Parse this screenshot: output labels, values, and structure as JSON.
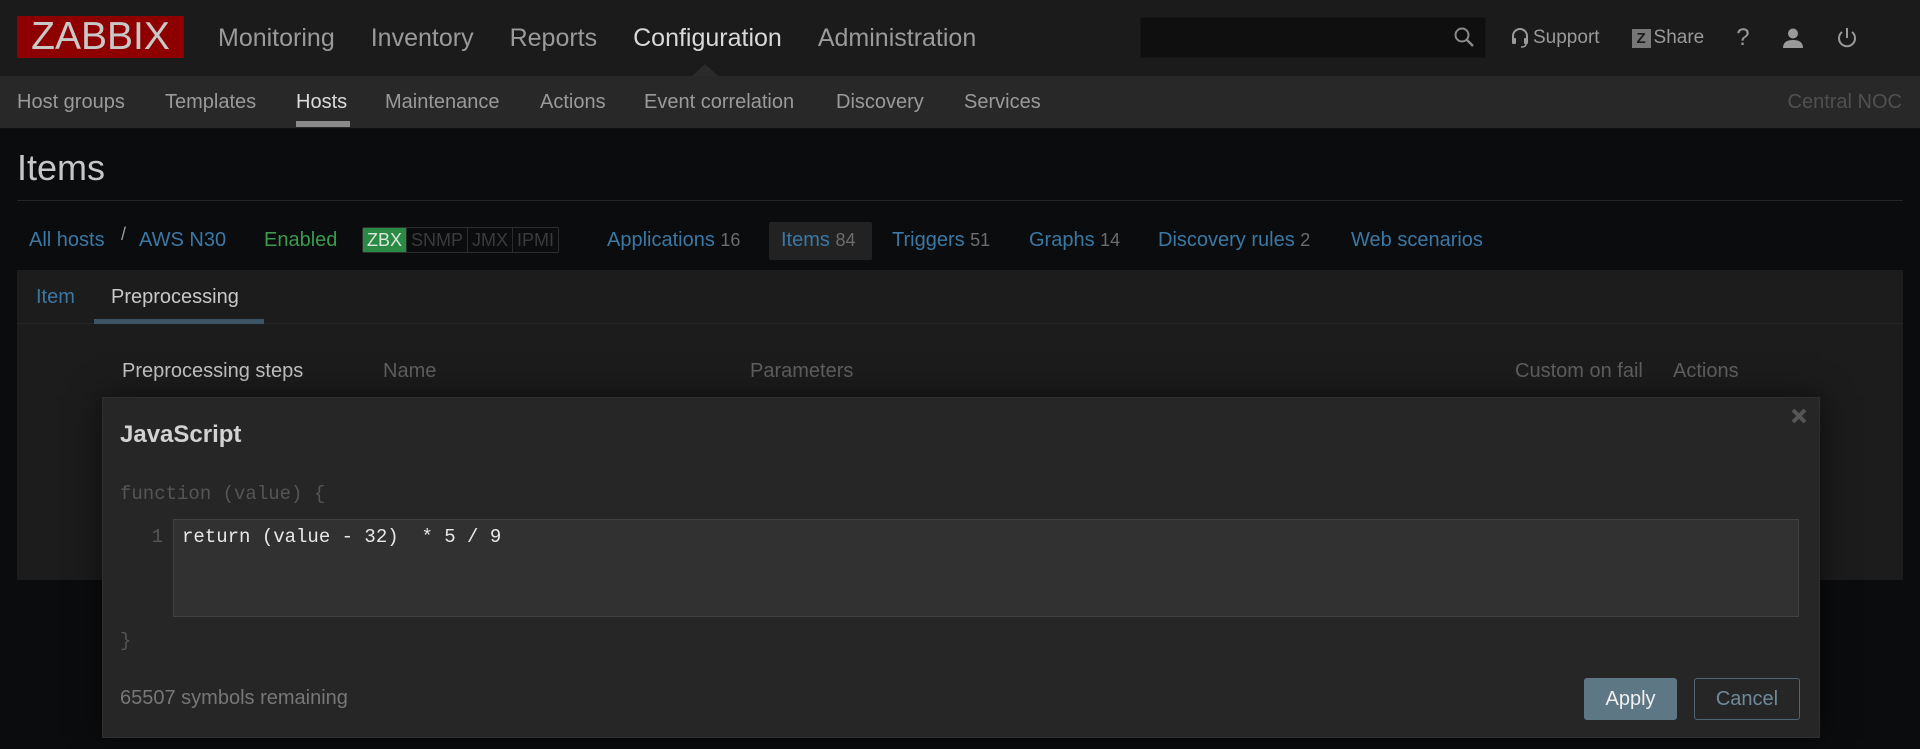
{
  "app": {
    "logo": "ZABBIX",
    "brand_color": "#8e0000",
    "accent_color": "#3b78a4"
  },
  "mainnav": {
    "items": [
      {
        "label": "Monitoring"
      },
      {
        "label": "Inventory"
      },
      {
        "label": "Reports"
      },
      {
        "label": "Configuration",
        "active": true
      },
      {
        "label": "Administration"
      }
    ]
  },
  "header_tools": {
    "search_placeholder": "",
    "search_icon": "search-icon",
    "support_label": "Support",
    "share_badge": "Z",
    "share_label": "Share",
    "help_label": "?",
    "user_icon": "user-icon",
    "logout_icon": "power-icon"
  },
  "subnav": {
    "items": [
      {
        "label": "Host groups"
      },
      {
        "label": "Templates"
      },
      {
        "label": "Hosts",
        "active": true
      },
      {
        "label": "Maintenance"
      },
      {
        "label": "Actions"
      },
      {
        "label": "Event correlation"
      },
      {
        "label": "Discovery"
      },
      {
        "label": "Services"
      }
    ],
    "server_name": "Central NOC"
  },
  "page": {
    "title": "Items"
  },
  "hostbar": {
    "all_hosts": "All hosts",
    "separator": "/",
    "host": "AWS N30",
    "status": "Enabled",
    "availability": [
      {
        "label": "ZBX",
        "active": true
      },
      {
        "label": "SNMP",
        "active": false
      },
      {
        "label": "JMX",
        "active": false
      },
      {
        "label": "IPMI",
        "active": false
      }
    ],
    "links": [
      {
        "label": "Applications",
        "count": "16"
      },
      {
        "label": "Items",
        "count": "84",
        "active": true
      },
      {
        "label": "Triggers",
        "count": "51"
      },
      {
        "label": "Graphs",
        "count": "14"
      },
      {
        "label": "Discovery rules",
        "count": "2"
      },
      {
        "label": "Web scenarios",
        "count": ""
      }
    ]
  },
  "tabs": {
    "item": "Item",
    "preprocessing": "Preprocessing",
    "active": "Preprocessing"
  },
  "preprocessing_table": {
    "headers": {
      "steps": "Preprocessing steps",
      "name": "Name",
      "parameters": "Parameters",
      "custom_on_fail": "Custom on fail",
      "actions": "Actions"
    }
  },
  "dialog": {
    "title": "JavaScript",
    "prefix": "function (value) {",
    "line_number": "1",
    "code": "return (value - 32)  * 5 / 9",
    "suffix": "}",
    "remaining": "65507 symbols remaining",
    "apply_label": "Apply",
    "cancel_label": "Cancel"
  }
}
